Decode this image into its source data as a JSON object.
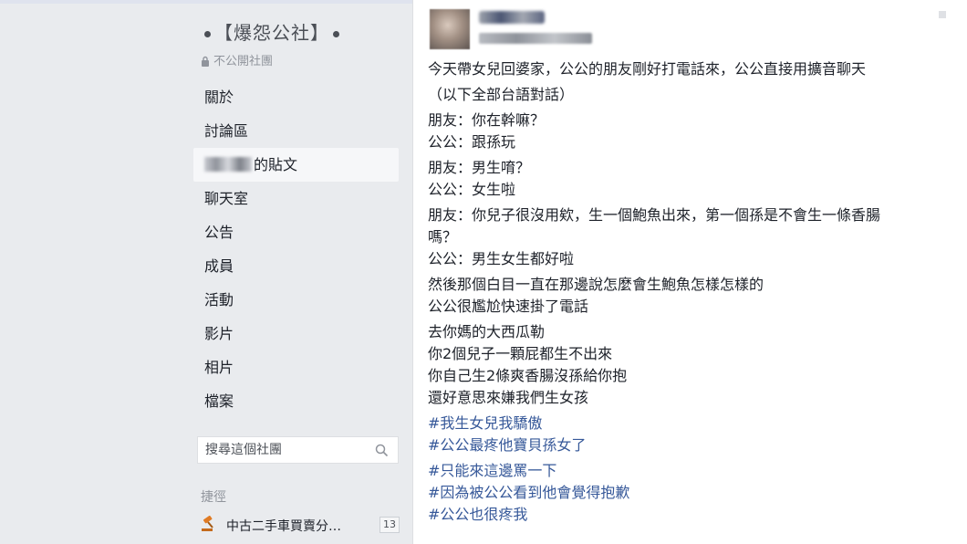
{
  "sidebar": {
    "group_name": "【爆怨公社】",
    "privacy_label": "不公開社團",
    "nav": [
      {
        "label": "關於"
      },
      {
        "label": "討論區"
      },
      {
        "label": "的貼文"
      },
      {
        "label": "聊天室"
      },
      {
        "label": "公告"
      },
      {
        "label": "成員"
      },
      {
        "label": "活動"
      },
      {
        "label": "影片"
      },
      {
        "label": "相片"
      },
      {
        "label": "檔案"
      }
    ],
    "search_placeholder": "搜尋這個社團",
    "shortcuts_title": "捷徑",
    "shortcut": {
      "label": "中古二手車買賣分…",
      "badge": "13"
    }
  },
  "post": {
    "paragraphs": [
      [
        "今天帶女兒回婆家，公公的朋友剛好打電話來，公公直接用擴音聊天"
      ],
      [
        "（以下全部台語對話）"
      ],
      [
        "朋友：你在幹嘛？",
        "公公：跟孫玩"
      ],
      [
        "朋友：男生唷？",
        "公公：女生啦"
      ],
      [
        "朋友：你兒子很沒用欸，生一個鮑魚出來，第一個孫是不會生一條香腸",
        "嗎？",
        "公公：男生女生都好啦"
      ],
      [
        "然後那個白目一直在那邊說怎麼會生鮑魚怎樣怎樣的",
        "公公很尷尬快速掛了電話"
      ],
      [
        "去你媽的大西瓜勒",
        "你2個兒子一顆屁都生不出來",
        "你自己生2條爽香腸沒孫給你抱",
        "還好意思來嫌我們生女孩"
      ]
    ],
    "hashtag_groups": [
      [
        "#我生女兒我驕傲",
        "#公公最疼他寶貝孫女了"
      ],
      [
        "#只能來這邊罵一下",
        "#因為被公公看到他會覺得抱歉",
        "#公公也很疼我"
      ]
    ]
  },
  "colors": {
    "page_bg": "#e9ebee",
    "hashtag": "#365899",
    "text": "#1d2129"
  }
}
